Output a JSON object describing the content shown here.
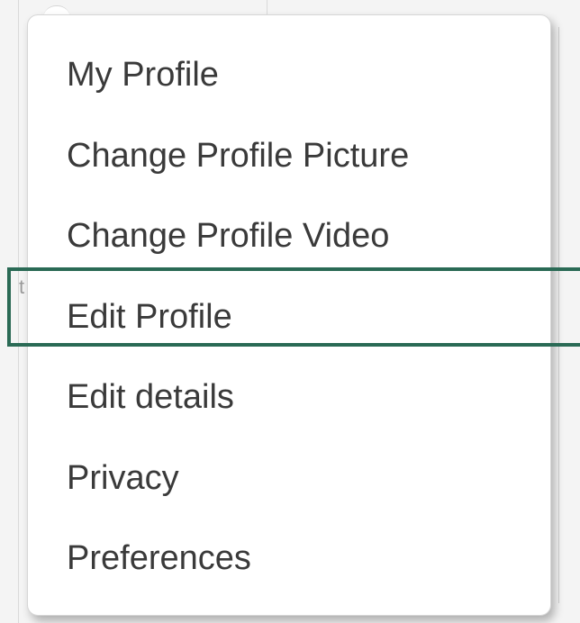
{
  "menu": {
    "items": [
      {
        "label": "My Profile"
      },
      {
        "label": "Change Profile Picture"
      },
      {
        "label": "Change Profile Video"
      },
      {
        "label": "Edit Profile"
      },
      {
        "label": "Edit details"
      },
      {
        "label": "Privacy"
      },
      {
        "label": "Preferences"
      }
    ],
    "highlighted_item": "Edit Profile"
  },
  "colors": {
    "highlight_border": "#2a6a55",
    "text": "#3a3a3a",
    "menu_background": "#ffffff"
  },
  "background": {
    "stray_char": "t"
  }
}
